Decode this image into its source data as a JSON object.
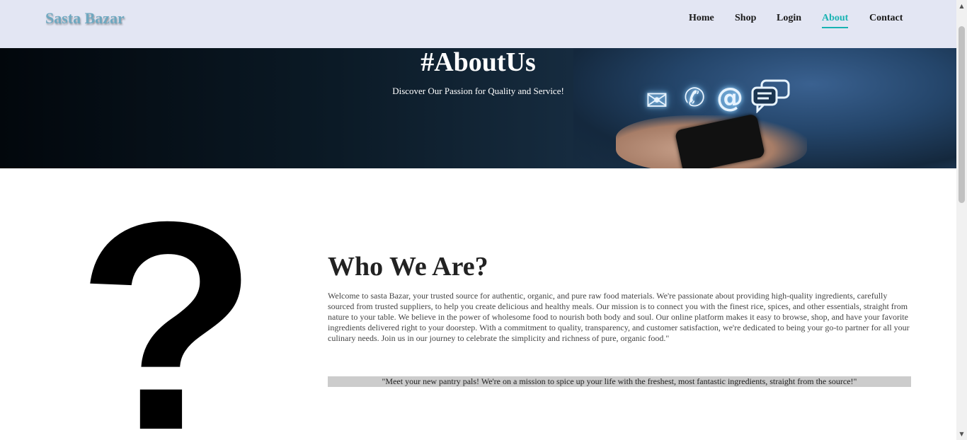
{
  "header": {
    "logo": "Sasta Bazar",
    "nav": [
      {
        "label": "Home",
        "active": false
      },
      {
        "label": "Shop",
        "active": false
      },
      {
        "label": "Login",
        "active": false
      },
      {
        "label": "About",
        "active": true
      },
      {
        "label": "Contact",
        "active": false
      }
    ]
  },
  "hero": {
    "title": "#AboutUs",
    "subtitle": "Discover Our Passion for Quality and Service!",
    "icons": [
      "envelope-icon",
      "phone-icon",
      "at-sign-icon",
      "chat-bubbles-icon"
    ]
  },
  "about": {
    "image_glyph": "?",
    "heading": "Who We Are?",
    "text": "Welcome to sasta Bazar, your trusted source for authentic, organic, and pure raw food materials. We're passionate about providing high-quality ingredients, carefully sourced from trusted suppliers, to help you create delicious and healthy meals. Our mission is to connect you with the finest rice, spices, and other essentials, straight from nature to your table. We believe in the power of wholesome food to nourish both body and soul. Our online platform makes it easy to browse, shop, and have your favorite ingredients delivered right to your doorstep. With a commitment to quality, transparency, and customer satisfaction, we're dedicated to being your go-to partner for all your culinary needs. Join us in our journey to celebrate the simplicity and richness of pure, organic food.\"",
    "quote": "\"Meet your new pantry pals! We're on a mission to spice up your life with the freshest, most fantastic ingredients, straight from the source!\""
  },
  "colors": {
    "header_bg": "#e3e6f3",
    "accent": "#19b3b3",
    "logo": "#6fa8c0",
    "quote_bg": "#cccccc"
  }
}
